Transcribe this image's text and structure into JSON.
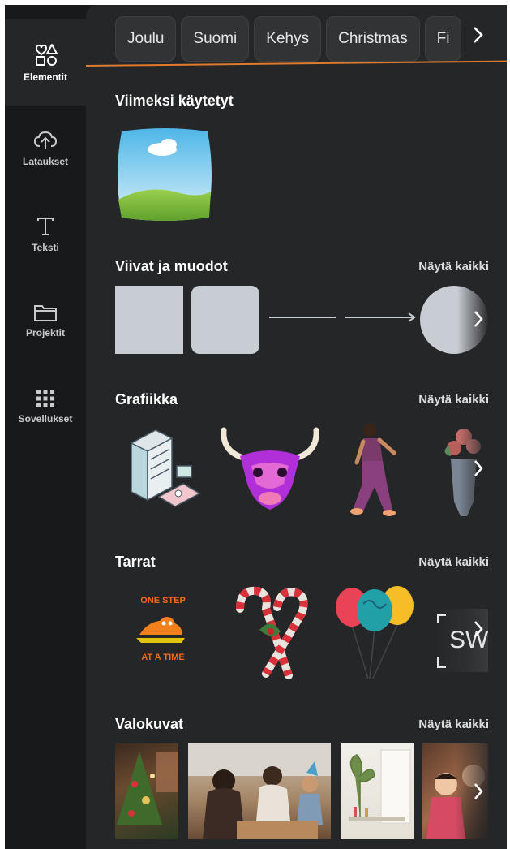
{
  "rail": {
    "items": [
      {
        "label": "Elementit",
        "icon": "elements-icon"
      },
      {
        "label": "Lataukset",
        "icon": "upload-cloud-icon"
      },
      {
        "label": "Teksti",
        "icon": "text-icon"
      },
      {
        "label": "Projektit",
        "icon": "folder-icon"
      },
      {
        "label": "Sovellukset",
        "icon": "apps-grid-icon"
      }
    ]
  },
  "chips": [
    "Joulu",
    "Suomi",
    "Kehys",
    "Christmas",
    "Fi"
  ],
  "sections": {
    "recent": {
      "title": "Viimeksi käytetyt"
    },
    "shapes": {
      "title": "Viivat ja muodot",
      "see_all": "Näytä kaikki"
    },
    "graphics": {
      "title": "Grafiikka",
      "see_all": "Näytä kaikki"
    },
    "stickers": {
      "title": "Tarrat",
      "see_all": "Näytä kaikki",
      "sticker_text_top": "ONE STEP",
      "sticker_text_bottom": "AT A TIME",
      "sw_text": "SW"
    },
    "photos": {
      "title": "Valokuvat",
      "see_all": "Näytä kaikki"
    }
  },
  "colors": {
    "rail_bg": "#18191b",
    "panel_bg": "#252627",
    "accent_line": "#e07a2e",
    "shape_fill": "#c8ccd3"
  }
}
